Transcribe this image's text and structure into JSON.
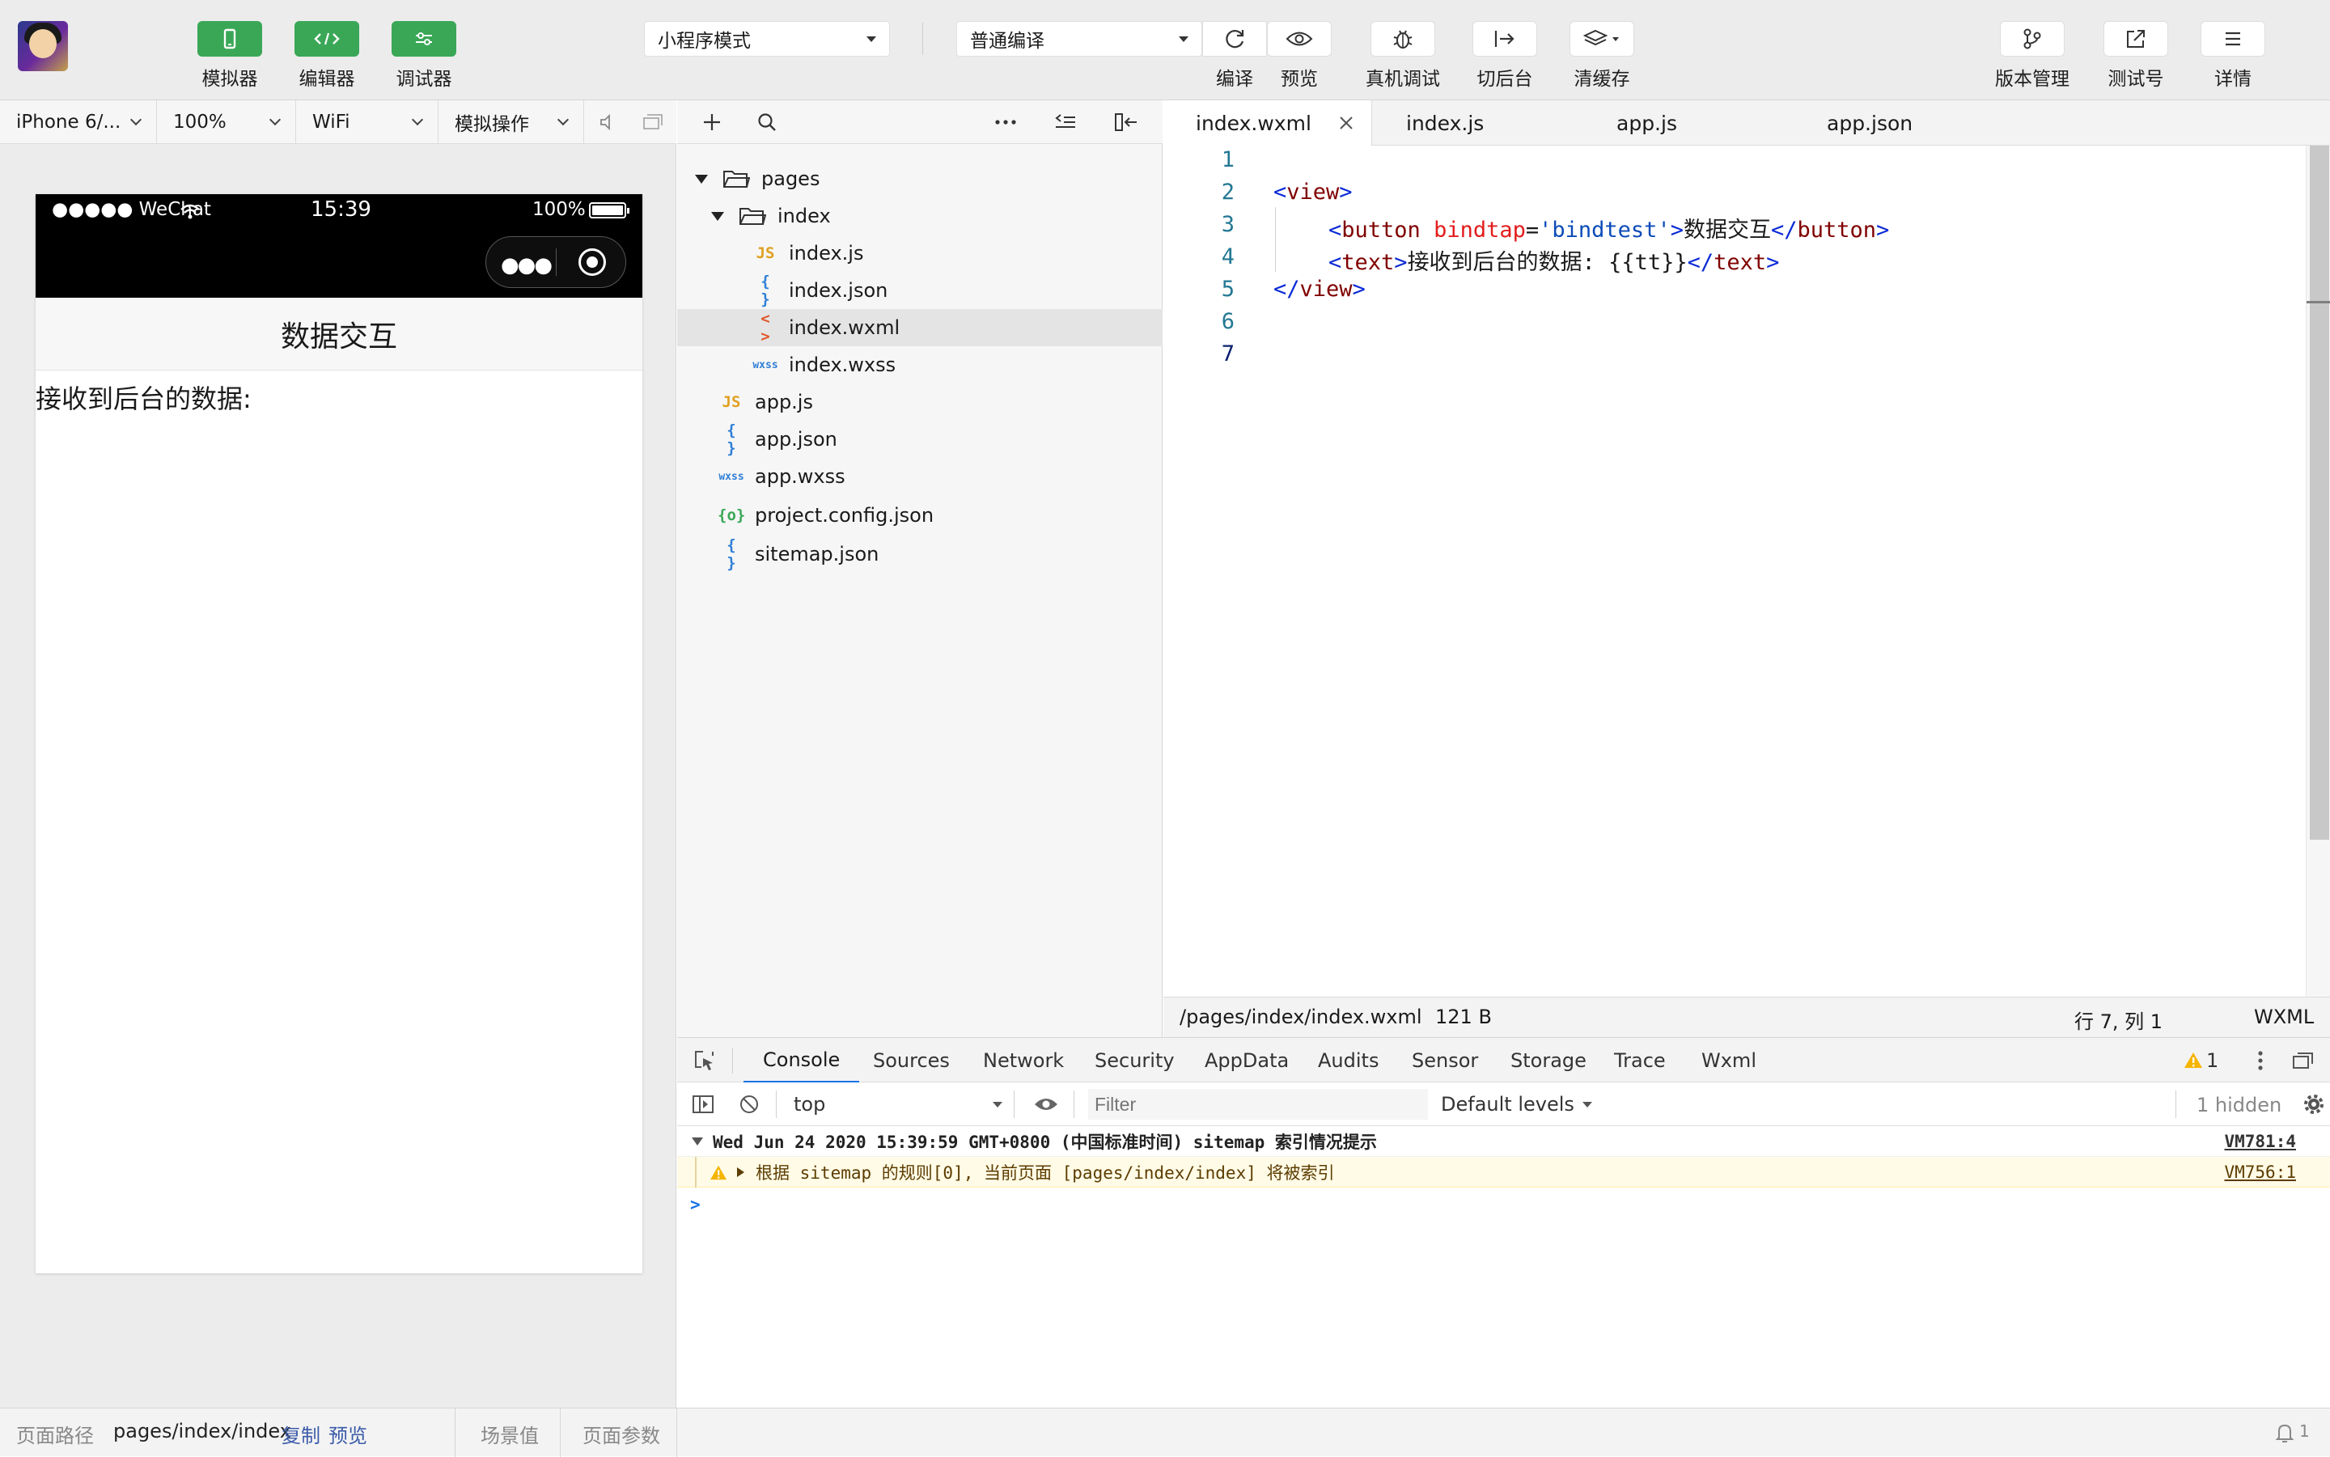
{
  "toolbar": {
    "simulator_label": "模拟器",
    "editor_label": "编辑器",
    "debugger_label": "调试器",
    "mode_select": "小程序模式",
    "compile_select": "普通编译",
    "compile_label": "编译",
    "preview_label": "预览",
    "remote_debug_label": "真机调试",
    "background_label": "切后台",
    "clear_cache_label": "清缓存",
    "version_label": "版本管理",
    "test_account_label": "测试号",
    "details_label": "详情"
  },
  "simbar": {
    "device": "iPhone 6/...",
    "zoom": "100%",
    "network": "WiFi",
    "operation": "模拟操作"
  },
  "phone": {
    "carrier": "●●●●● WeChat",
    "time": "15:39",
    "battery": "100%",
    "nav_title": "数据交互",
    "body_text": "接收到后台的数据:"
  },
  "sim_footer": {
    "path_label": "页面路径",
    "path_value": "pages/index/index",
    "copy": "复制",
    "preview": "预览",
    "scene": "场景值",
    "params": "页面参数",
    "bell_count": "1"
  },
  "filetree": {
    "items": [
      {
        "name": "pages",
        "icon": "folder-open-icon"
      },
      {
        "name": "index",
        "icon": "folder-open-icon"
      },
      {
        "name": "index.js",
        "icon": "js-file-icon",
        "glyph": "JS"
      },
      {
        "name": "index.json",
        "icon": "json-file-icon",
        "glyph": "{ }"
      },
      {
        "name": "index.wxml",
        "icon": "wxml-file-icon",
        "glyph": "< >"
      },
      {
        "name": "index.wxss",
        "icon": "wxss-file-icon",
        "glyph": "wxss"
      },
      {
        "name": "app.js",
        "icon": "js-file-icon",
        "glyph": "JS"
      },
      {
        "name": "app.json",
        "icon": "json-file-icon",
        "glyph": "{ }"
      },
      {
        "name": "app.wxss",
        "icon": "wxss-file-icon",
        "glyph": "wxss"
      },
      {
        "name": "project.config.json",
        "icon": "config-file-icon",
        "glyph": "{o}"
      },
      {
        "name": "sitemap.json",
        "icon": "json-file-icon",
        "glyph": "{ }"
      }
    ]
  },
  "editor": {
    "tabs": [
      "index.wxml",
      "index.js",
      "app.js",
      "app.json"
    ],
    "line_numbers": [
      "1",
      "2",
      "3",
      "4",
      "5",
      "6",
      "7"
    ],
    "code": {
      "l2_open": "<",
      "l2_tag": "view",
      "l2_close": ">",
      "l3_open": "<",
      "l3_tag": "button",
      "l3_attr": "bindtap",
      "l3_eq": "=",
      "l3_val": "'bindtest'",
      "l3_gt": ">",
      "l3_text": "数据交互",
      "l3_end_open": "</",
      "l3_end_tag": "button",
      "l3_end_gt": ">",
      "l4_open": "<",
      "l4_tag": "text",
      "l4_gt": ">",
      "l4_text": "接收到后台的数据: {{tt}}",
      "l4_end_open": "</",
      "l4_end_tag": "text",
      "l4_end_gt": ">",
      "l5_open": "</",
      "l5_tag": "view",
      "l5_close": ">"
    },
    "status": {
      "path": "/pages/index/index.wxml",
      "size": "121 B",
      "position": "行 7, 列 1",
      "language": "WXML"
    }
  },
  "devtools": {
    "tabs": [
      "Console",
      "Sources",
      "Network",
      "Security",
      "AppData",
      "Audits",
      "Sensor",
      "Storage",
      "Trace",
      "Wxml"
    ],
    "warning_count": "1",
    "context": "top",
    "filter_placeholder": "Filter",
    "levels": "Default levels",
    "hidden": "1 hidden",
    "console": {
      "group_title": "Wed Jun 24 2020 15:39:59 GMT+0800 (中国标准时间) sitemap 索引情况提示",
      "group_source": "VM781:4",
      "warning_text": "根据 sitemap 的规则[0], 当前页面 [pages/index/index] 将被索引",
      "warning_source": "VM756:1",
      "prompt": ">"
    }
  },
  "colors": {
    "green": "#3aa757",
    "warning_bg": "#fffbe6",
    "warning_text": "#5c3c00",
    "js_icon": "#e0a020",
    "json_icon": "#2f7fd6",
    "wxml_icon": "#e2572a",
    "wxss_icon": "#2f7fd6",
    "config_icon": "#3aa757"
  }
}
